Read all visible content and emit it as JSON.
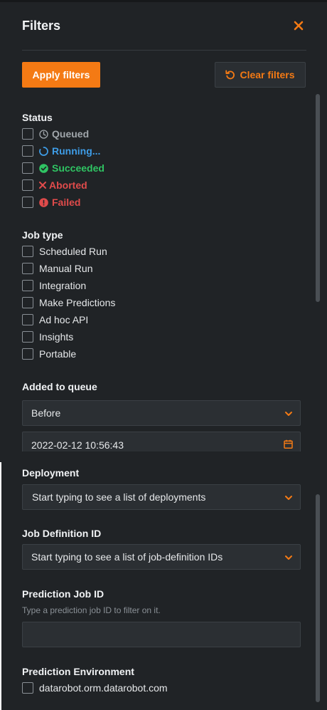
{
  "panel": {
    "title": "Filters",
    "close_icon": "close-icon"
  },
  "actions": {
    "apply_label": "Apply filters",
    "clear_label": "Clear filters",
    "clear_icon": "undo-icon"
  },
  "status": {
    "title": "Status",
    "items": [
      {
        "label": "Queued",
        "icon": "clock-icon",
        "color": "#a0a6ab"
      },
      {
        "label": "Running...",
        "icon": "spinner-icon",
        "color": "#3e9ce6"
      },
      {
        "label": "Succeeded",
        "icon": "check-circle-icon",
        "color": "#2fc463"
      },
      {
        "label": "Aborted",
        "icon": "x-icon",
        "color": "#e04b4b"
      },
      {
        "label": "Failed",
        "icon": "exclamation-circle-icon",
        "color": "#e04b4b"
      }
    ]
  },
  "job_type": {
    "title": "Job type",
    "items": [
      "Scheduled Run",
      "Manual Run",
      "Integration",
      "Make Predictions",
      "Ad hoc API",
      "Insights",
      "Portable"
    ]
  },
  "added_to_queue": {
    "title": "Added to queue",
    "select_value": "Before",
    "date_value": "2022-02-12 10:56:43"
  },
  "deployment": {
    "title": "Deployment",
    "placeholder": "Start typing to see a list of deployments"
  },
  "job_definition": {
    "title": "Job Definition ID",
    "placeholder": "Start typing to see a list of job-definition IDs"
  },
  "prediction_job": {
    "title": "Prediction Job ID",
    "hint": "Type a prediction job ID to filter on it.",
    "value": ""
  },
  "prediction_env": {
    "title": "Prediction Environment",
    "items": [
      "datarobot.orm.datarobot.com"
    ]
  },
  "colors": {
    "accent": "#f47a14",
    "background": "#202326"
  }
}
